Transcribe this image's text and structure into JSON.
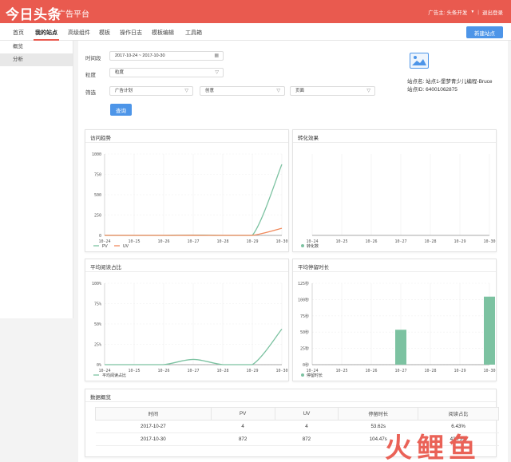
{
  "header": {
    "logo": "今日头条",
    "subtitle": "广告平台",
    "advertiser": "广告主: 头条开发",
    "logout": "退出登录"
  },
  "nav": {
    "items": [
      "首页",
      "我的站点",
      "高级组件",
      "模板",
      "操作日志",
      "模板编辑",
      "工具箱"
    ],
    "active": "我的站点",
    "new_site": "新建站点"
  },
  "sidebar": {
    "items": [
      "概览",
      "分析"
    ],
    "active": "分析"
  },
  "filters": {
    "period_label": "时间段",
    "period_value": "2017-10-24 ~ 2017-10-30",
    "granularity_label": "粒度",
    "granularity_value": "粒度",
    "filter_label": "筛选",
    "plan_value": "广告计划",
    "creative_value": "创意",
    "page_value": "页面",
    "query": "查询"
  },
  "site": {
    "name_label": "站点名:",
    "name_value": "站点1-堡梦青少儿编程-Bruce",
    "id_label": "站点ID:",
    "id_value": "64001062875"
  },
  "colors": {
    "pv": "#7cc2a1",
    "uv": "#f08a5d",
    "bar": "#7cc2a1",
    "accent": "#e95a4f",
    "primary": "#4d95e8"
  },
  "chart_data": [
    {
      "type": "line",
      "title": "访问趋势",
      "x": [
        "10-24",
        "10-25",
        "10-26",
        "10-27",
        "10-28",
        "10-29",
        "10-30"
      ],
      "ylim": [
        0,
        1000
      ],
      "yticks": [
        "1000",
        "750",
        "500",
        "250",
        "0"
      ],
      "series": [
        {
          "name": "PV",
          "values": [
            0,
            0,
            0,
            4,
            0,
            0,
            872
          ]
        },
        {
          "name": "UV",
          "values": [
            0,
            0,
            0,
            4,
            0,
            0,
            872
          ]
        }
      ],
      "legend": [
        "PV",
        "UV"
      ],
      "grid": true
    },
    {
      "type": "line",
      "title": "转化效果",
      "x": [
        "10-24",
        "10-25",
        "10-26",
        "10-27",
        "10-28",
        "10-29",
        "10-30"
      ],
      "series": [
        {
          "name": "转化数",
          "values": []
        }
      ],
      "legend": [
        "转化数"
      ],
      "grid": true
    },
    {
      "type": "line",
      "title": "平均阅读占比",
      "x": [
        "10-24",
        "10-25",
        "10-26",
        "10-27",
        "10-28",
        "10-29",
        "10-30"
      ],
      "ylim": [
        0,
        100
      ],
      "yticks": [
        "100%",
        "75%",
        "50%",
        "25%",
        "0%"
      ],
      "series": [
        {
          "name": "平均阅读占比",
          "values": [
            0,
            0,
            0,
            6.43,
            0,
            0,
            43.73
          ]
        }
      ],
      "legend": [
        "平均阅读占比"
      ],
      "grid": true
    },
    {
      "type": "bar",
      "title": "平均停留时长",
      "categories": [
        "10-24",
        "10-25",
        "10-26",
        "10-27",
        "10-28",
        "10-29",
        "10-30"
      ],
      "ylim": [
        0,
        125
      ],
      "yticks": [
        "125秒",
        "100秒",
        "75秒",
        "50秒",
        "25秒",
        "0秒"
      ],
      "values": [
        0,
        0,
        0,
        53.62,
        0,
        0,
        104.47
      ],
      "legend": [
        "停留时长"
      ],
      "grid": true
    }
  ],
  "table": {
    "title": "数据概览",
    "headers": [
      "时间",
      "PV",
      "UV",
      "停留时长",
      "阅读占比"
    ],
    "rows": [
      [
        "2017-10-27",
        "4",
        "4",
        "53.62s",
        "6.43%"
      ],
      [
        "2017-10-30",
        "872",
        "872",
        "104.47s",
        "43.73%"
      ]
    ]
  },
  "watermark": "火鲤鱼"
}
